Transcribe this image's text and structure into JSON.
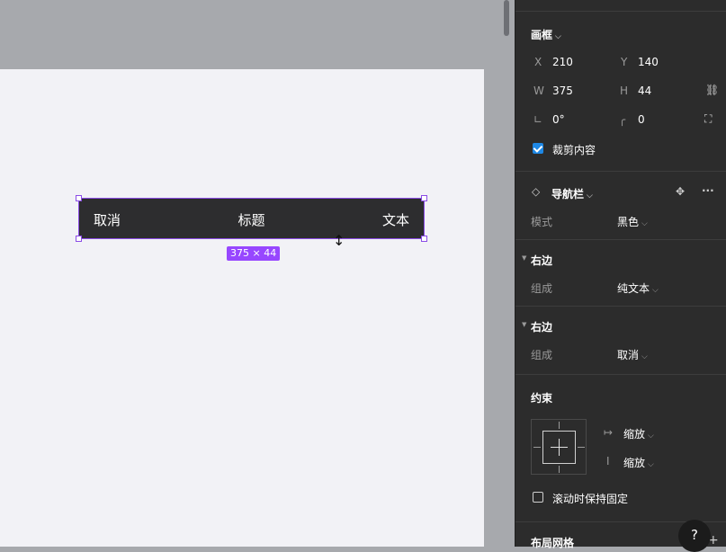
{
  "canvas": {
    "navbar": {
      "left_text": "取消",
      "title_text": "标题",
      "right_text": "文本"
    },
    "selection_dims": "375 × 44"
  },
  "panel": {
    "frame_section": {
      "title": "画框",
      "x_label": "X",
      "x_value": "210",
      "y_label": "Y",
      "y_value": "140",
      "w_label": "W",
      "w_value": "375",
      "h_label": "H",
      "h_value": "44",
      "rotation_value": "0°",
      "radius_value": "0",
      "clip_label": "裁剪内容",
      "clip_checked": true
    },
    "component_section": {
      "title": "导航栏",
      "mode_label": "模式",
      "mode_value": "黑色",
      "right1_title": "右边",
      "compose1_label": "组成",
      "compose1_value": "纯文本",
      "right2_title": "右边",
      "compose2_label": "组成",
      "compose2_value": "取消"
    },
    "constraints_section": {
      "title": "约束",
      "horizontal_value": "缩放",
      "vertical_value": "缩放",
      "fixed_scroll_label": "滚动时保持固定",
      "fixed_scroll_checked": false
    },
    "layout_grid_title": "布局网格",
    "help_label": "?"
  }
}
